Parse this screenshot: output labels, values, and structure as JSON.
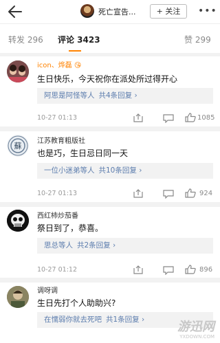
{
  "header": {
    "title": "死亡宣告...",
    "follow_label": "+ 关注",
    "more_label": "•••"
  },
  "tabs": [
    {
      "label": "转发 296"
    },
    {
      "label": "评论 3423",
      "active": true
    },
    {
      "label": "赞 299"
    }
  ],
  "colors": {
    "accent": "#ff8200",
    "reply_link": "#5b7cad"
  },
  "comments": [
    {
      "username": "icon、烨磊",
      "username_emoji": "😘",
      "text": "生日快乐，今天祝你在派处所过得开心",
      "replies_who": "阿思是阿怪等人",
      "replies_count": "共4条回复 ›",
      "time": "10-27 01:13",
      "likes": "1085"
    },
    {
      "username": "江苏教育粗版社",
      "text": "也是巧，生日忌日同一天",
      "replies_who": "一位小迷弟等人",
      "replies_count": "共10条回复 ›",
      "time": "10-27 01:13",
      "likes": "924"
    },
    {
      "username": "西红柿炒茄番",
      "text": "祭日到了，恭喜。",
      "replies_who": "思总等人",
      "replies_count": "共2条回复 ›",
      "time": "10-27 01:12",
      "likes": "896"
    },
    {
      "username": "调呀调",
      "text": "生日先打个人助助兴?",
      "replies_who": "在懦弱你就去死吧",
      "replies_count": "共1条回复 ›",
      "time": "",
      "likes": ""
    }
  ],
  "watermark": {
    "big": "游迅网",
    "small": "YXDOWN.COM"
  }
}
